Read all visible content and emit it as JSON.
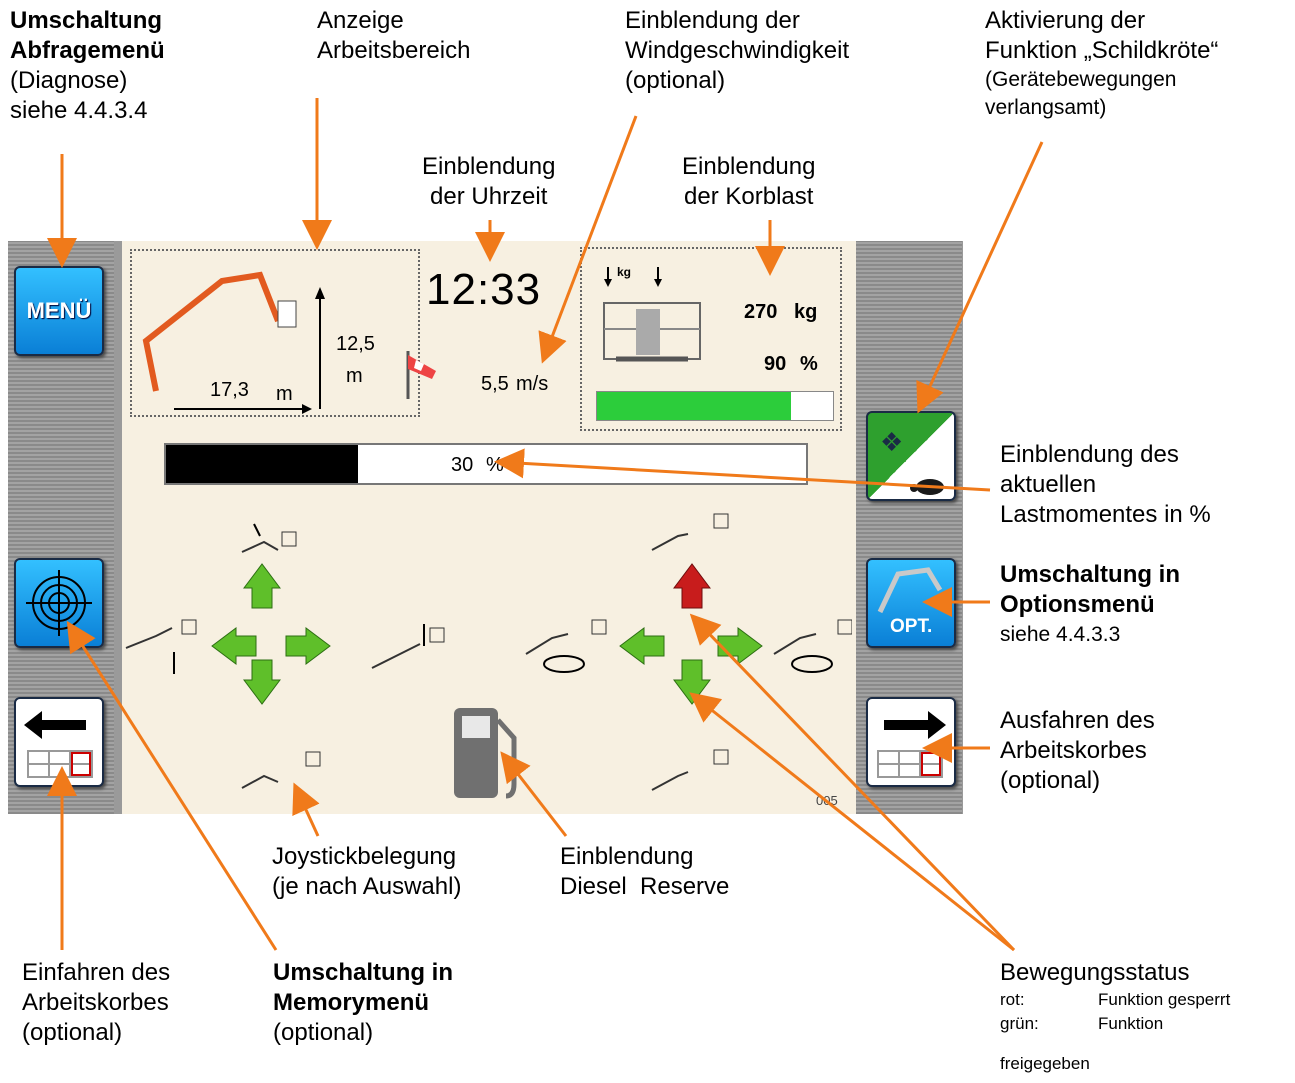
{
  "annotations": {
    "menu_switch": {
      "bold": "Umschaltung Abfragemenü",
      "lines": [
        "(Diagnose)",
        "siehe 4.4.3.4"
      ]
    },
    "work_area": {
      "lines": [
        "Anzeige",
        "Arbeitsbereich"
      ]
    },
    "wind": {
      "lines": [
        "Einblendung der",
        "Windgeschwindigkeit",
        "(optional)"
      ]
    },
    "turtle": {
      "lines": [
        "Aktivierung der",
        "Funktion „Schildkröte“"
      ],
      "small": [
        "(Gerätebewegungen",
        "verlangsamt)"
      ]
    },
    "clock": {
      "lines": [
        "Einblendung",
        "der Uhrzeit"
      ]
    },
    "basket_load": {
      "lines": [
        "Einblendung",
        "der Korblast"
      ]
    },
    "load_moment": {
      "lines": [
        "Einblendung des",
        "aktuellen",
        "Lastmomentes in %"
      ]
    },
    "options_menu": {
      "bold": "Umschaltung in Optionsmenü",
      "lines": [
        "siehe 4.4.3.3"
      ]
    },
    "extend_basket": {
      "lines": [
        "Ausfahren des",
        "Arbeitskorbes",
        "(optional)"
      ]
    },
    "joystick": {
      "lines": [
        "Joystickbelegung",
        "(je nach Auswahl)"
      ]
    },
    "diesel": {
      "lines": [
        "Einblendung",
        "Diesel  Reserve"
      ]
    },
    "retract_basket": {
      "lines": [
        "Einfahren des",
        "Arbeitskorbes",
        "(optional)"
      ]
    },
    "memory_menu": {
      "bold": "Umschaltung in Memorymenü",
      "lines": [
        "(optional)"
      ]
    },
    "movement_status": {
      "lines": [
        "Bewegungsstatus"
      ],
      "legend": [
        {
          "key": "rot:",
          "value": "Funktion gesperrt"
        },
        {
          "key": "grün:",
          "value": "Funktion"
        }
      ],
      "extra": "freigegeben"
    }
  },
  "screen": {
    "menu_button": "MENÜ",
    "opt_button": "OPT.",
    "time": "12:33",
    "reach": {
      "value": "17,3",
      "unit": "m"
    },
    "height": {
      "value": "12,5",
      "unit": "m"
    },
    "wind": {
      "value": "5,5",
      "unit": "m/s"
    },
    "load_icon_label": "kg",
    "load": {
      "value": "270",
      "unit": "kg"
    },
    "load_percent": {
      "value": "90",
      "unit": "%"
    },
    "load_bar_level": 0.82,
    "moment": {
      "value": "30",
      "unit": "%"
    },
    "moment_level": 0.3,
    "footer_code": "005"
  },
  "colors": {
    "accent_arrow": "#f07a1a",
    "enabled": "#5fbf2a",
    "locked": "#c81c1c",
    "panel": "#f7f0e1"
  }
}
